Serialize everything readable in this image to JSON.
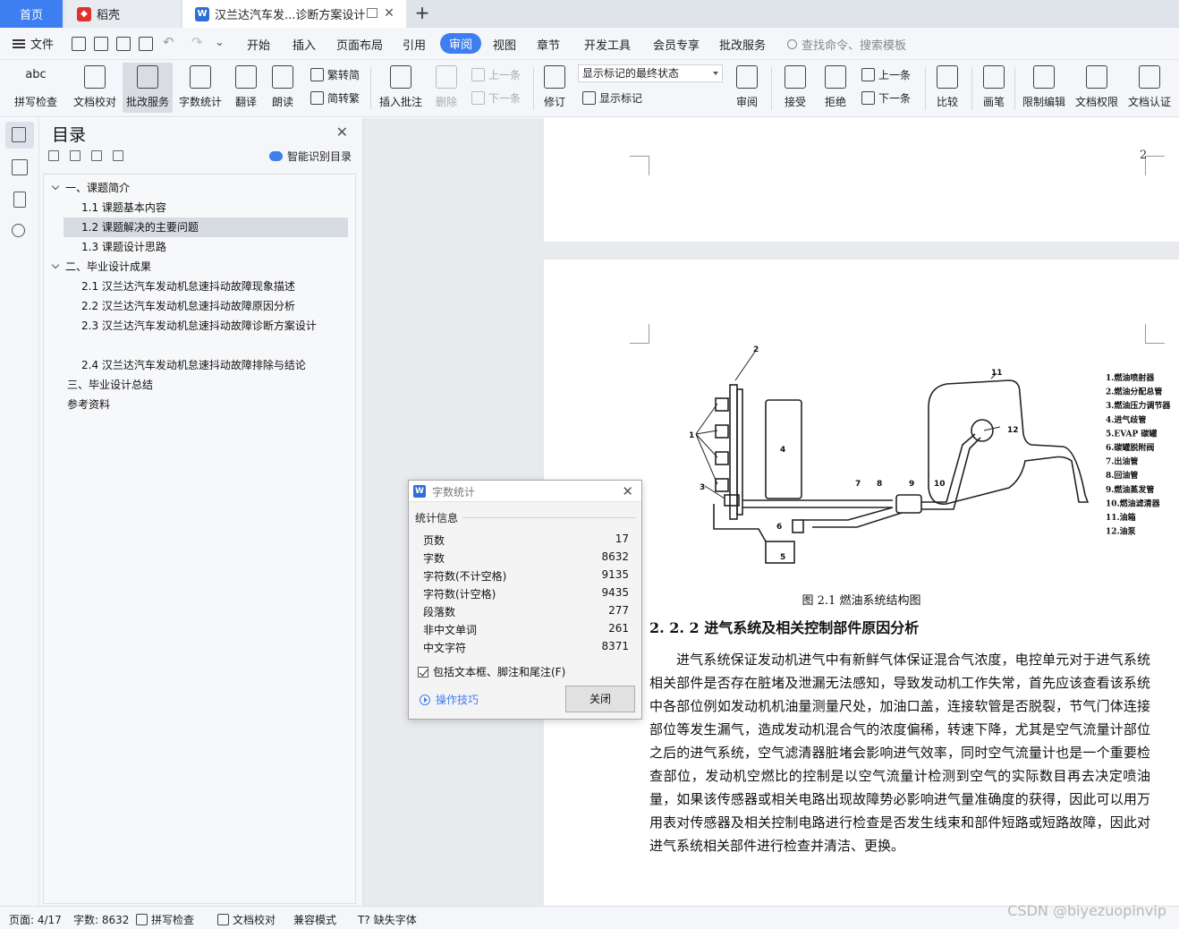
{
  "tabs": {
    "home": "首页",
    "daoke": "稻壳",
    "doc": "汉兰达汽车发...诊断方案设计"
  },
  "menu": {
    "file": "文件",
    "items": [
      "开始",
      "插入",
      "页面布局",
      "引用",
      "审阅",
      "视图",
      "章节",
      "开发工具",
      "会员专享",
      "批改服务"
    ],
    "active": "审阅",
    "search_placeholder": "查找命令、搜索模板"
  },
  "ribbon": {
    "spellcheck": "拼写检查",
    "proofread": "文档校对",
    "correction": "批改服务",
    "wordcount": "字数统计",
    "translate": "翻译",
    "read_aloud": "朗读",
    "trad_to_simp": "繁转简",
    "simp_to_trad": "简转繁",
    "insert_comment": "插入批注",
    "delete": "删除",
    "prev_comment": "上一条",
    "next_comment": "下一条",
    "track_changes": "修订",
    "markup_state": "显示标记的最终状态",
    "show_markup": "显示标记",
    "review": "审阅",
    "accept": "接受",
    "reject": "拒绝",
    "prev_change": "上一条",
    "next_change": "下一条",
    "compare": "比较",
    "ink": "画笔",
    "restrict_edit": "限制编辑",
    "doc_permission": "文档权限",
    "doc_certify": "文档认证"
  },
  "toc": {
    "title": "目录",
    "smart_toc": "智能识别目录",
    "items": [
      {
        "text": "一、课题简介",
        "level": 1,
        "expanded": true
      },
      {
        "text": "1.1 课题基本内容",
        "level": 2
      },
      {
        "text": "1.2 课题解决的主要问题",
        "level": 2,
        "selected": true
      },
      {
        "text": "1.3 课题设计思路",
        "level": 2
      },
      {
        "text": "二、毕业设计成果",
        "level": 1,
        "expanded": true
      },
      {
        "text": "2.1 汉兰达汽车发动机怠速抖动故障现象描述",
        "level": 2
      },
      {
        "text": "2.2  汉兰达汽车发动机怠速抖动故障原因分析",
        "level": 2
      },
      {
        "text": "2.3 汉兰达汽车发动机怠速抖动故障诊断方案设计",
        "level": 2
      },
      {
        "text": "2.4 汉兰达汽车发动机怠速抖动故障排除与结论",
        "level": 2
      },
      {
        "text": "三、毕业设计总结",
        "level": 1
      },
      {
        "text": "参考资料",
        "level": 0
      }
    ]
  },
  "document": {
    "page_number": "2",
    "figure_labels": [
      "1.燃油喷射器",
      "2.燃油分配总管",
      "3.燃油压力调节器",
      "4.进气歧管",
      "5.EVAP 碳罐",
      "6.碳罐脱附阀",
      "7.出油管",
      "8.回油管",
      "9.燃油蒸发管",
      "10.燃油滤清器",
      "11.油箱",
      "12.油泵"
    ],
    "figure_callouts": [
      "1",
      "2",
      "3",
      "4",
      "5",
      "6",
      "7",
      "8",
      "9",
      "10",
      "11",
      "12"
    ],
    "caption": "图 2.1 燃油系统结构图",
    "section_heading": "2. 2. 2 进气系统及相关控制部件原因分析",
    "paragraph": "进气系统保证发动机进气中有新鲜气体保证混合气浓度，电控单元对于进气系统相关部件是否存在脏堵及泄漏无法感知，导致发动机工作失常，首先应该查看该系统中各部位例如发动机机油量测量尺处，加油口盖，连接软管是否脱裂，节气门体连接部位等发生漏气，造成发动机混合气的浓度偏稀，转速下降，尤其是空气流量计部位之后的进气系统，空气滤清器脏堵会影响进气效率，同时空气流量计也是一个重要检查部位，发动机空燃比的控制是以空气流量计检测到空气的实际数目再去决定喷油量，如果该传感器或相关电路出现故障势必影响进气量准确度的获得，因此可以用万用表对传感器及相关控制电路进行检查是否发生线束和部件短路或短路故障，因此对进气系统相关部件进行检查并清洁、更换。"
  },
  "dialog": {
    "title": "字数统计",
    "group": "统计信息",
    "stats": [
      {
        "label": "页数",
        "value": "17"
      },
      {
        "label": "字数",
        "value": "8632"
      },
      {
        "label": "字符数(不计空格)",
        "value": "9135"
      },
      {
        "label": "字符数(计空格)",
        "value": "9435"
      },
      {
        "label": "段落数",
        "value": "277"
      },
      {
        "label": "非中文单词",
        "value": "261"
      },
      {
        "label": "中文字符",
        "value": "8371"
      }
    ],
    "include_label": "包括文本框、脚注和尾注(F)",
    "include_checked": true,
    "tips": "操作技巧",
    "close": "关闭"
  },
  "status": {
    "page": "页面: 4/17",
    "words": "字数: 8632",
    "spellcheck": "拼写检查",
    "proofread": "文档校对",
    "compat": "兼容模式",
    "missing_font": "缺失字体"
  },
  "watermark": "CSDN @biyezuopinvip"
}
